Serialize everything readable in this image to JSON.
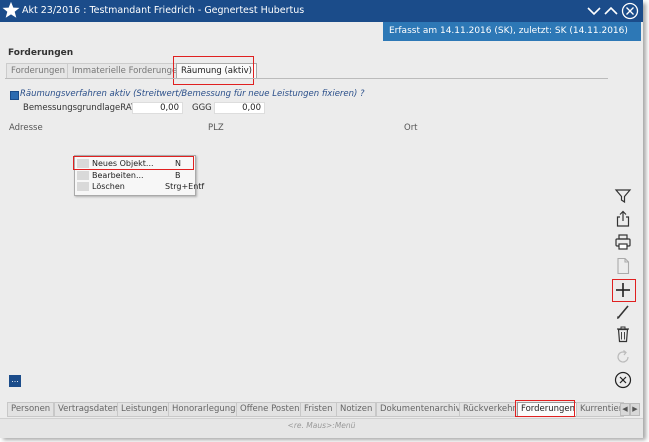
{
  "window": {
    "title": "Akt 23/2016 : Testmandant Friedrich - Gegnertest Hubertus",
    "info": "Erfasst am 14.11.2016 (SK), zuletzt: SK (14.11.2016)"
  },
  "section": {
    "title": "Forderungen",
    "tabs": [
      {
        "label": "Forderungen"
      },
      {
        "label": "Immaterielle Forderungen"
      },
      {
        "label": "Räumung (aktiv)"
      }
    ]
  },
  "form": {
    "checkbox_label": "Räumungsverfahren aktiv (Streitwert/Bemessung für neue Leistungen fixieren) ?",
    "checkbox_checked": true,
    "base_label": "BemessungsgrundlageRATG",
    "base_value": "0,00",
    "ggg_label": "GGG",
    "ggg_value": "0,00",
    "columns": [
      "Adresse",
      "PLZ",
      "Ort"
    ]
  },
  "context_menu": {
    "items": [
      {
        "label": "Neues Objekt...",
        "shortcut": "N"
      },
      {
        "label": "Bearbeiten...",
        "shortcut": "B"
      },
      {
        "label": "Löschen",
        "shortcut": "Strg+Entf"
      }
    ]
  },
  "right_toolbar": {
    "icons": [
      "filter-icon",
      "export-icon",
      "print-icon",
      "document-icon",
      "add-icon",
      "edit-icon",
      "delete-icon",
      "refresh-icon",
      "close-icon"
    ]
  },
  "more_button": {
    "label": "..."
  },
  "bottom_tabs": [
    {
      "label": "Personen"
    },
    {
      "label": "Vertragsdaten"
    },
    {
      "label": "Leistungen"
    },
    {
      "label": "Honorarlegung"
    },
    {
      "label": "Offene Posten"
    },
    {
      "label": "Fristen"
    },
    {
      "label": "Notizen"
    },
    {
      "label": "Dokumentenarchiv"
    },
    {
      "label": "Rückverkehr"
    },
    {
      "label": "Forderungen"
    },
    {
      "label": "Kurrentien"
    }
  ],
  "status": {
    "hint": "<re. Maus>:Menü"
  },
  "colors": {
    "titlebar": "#1b4c8a",
    "info_bar": "#2d78b6",
    "highlight": "#e02020",
    "accent": "#1b4c8a"
  }
}
